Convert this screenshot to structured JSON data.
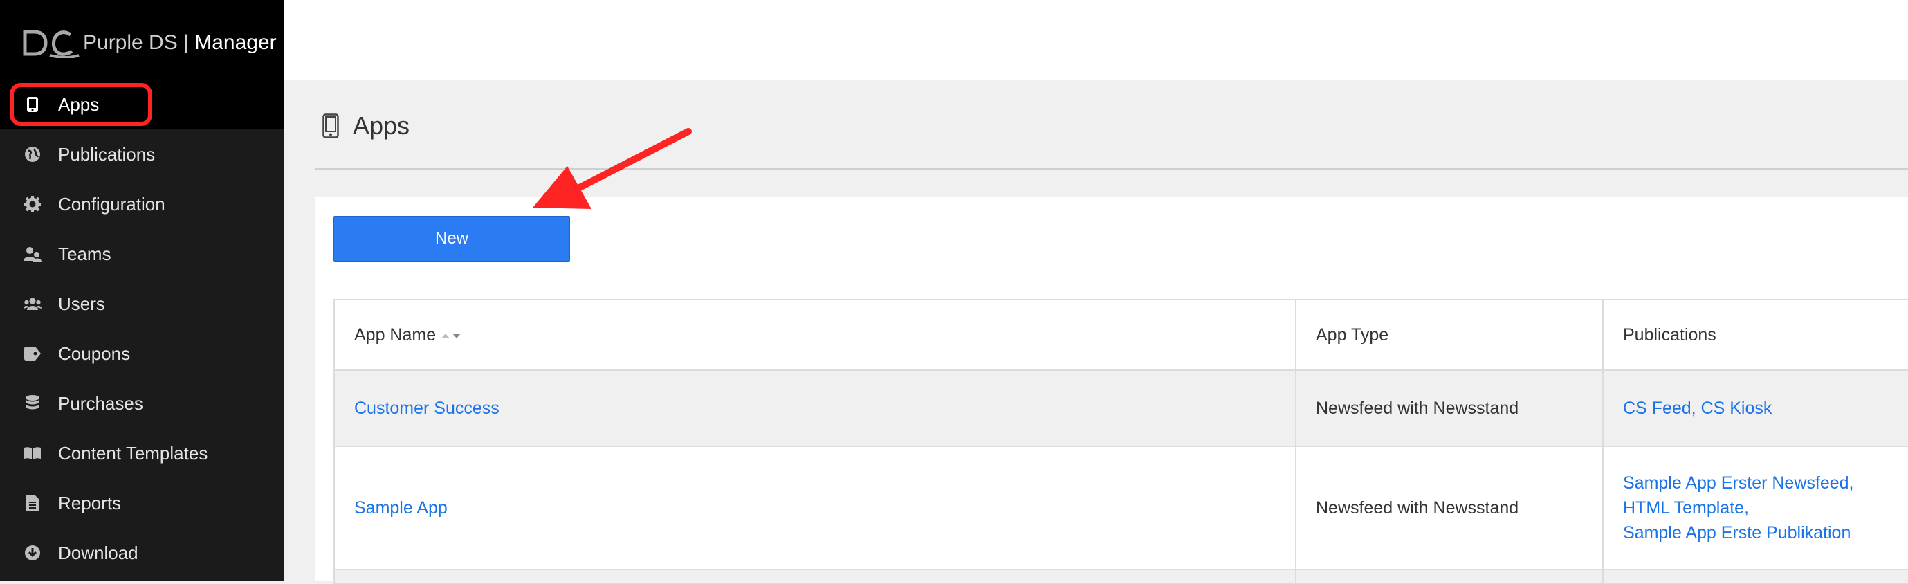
{
  "sidebar": {
    "brand": "Purple DS",
    "brand_separator": " | ",
    "brand_suffix": "Manager",
    "items": [
      {
        "label": "Apps",
        "icon": "tablet-icon",
        "active": true
      },
      {
        "label": "Publications",
        "icon": "globe-icon"
      },
      {
        "label": "Configuration",
        "icon": "gear-icon"
      },
      {
        "label": "Teams",
        "icon": "team-icon"
      },
      {
        "label": "Users",
        "icon": "users-icon"
      },
      {
        "label": "Coupons",
        "icon": "tag-icon"
      },
      {
        "label": "Purchases",
        "icon": "database-icon"
      },
      {
        "label": "Content Templates",
        "icon": "book-icon"
      },
      {
        "label": "Reports",
        "icon": "document-icon"
      },
      {
        "label": "Download",
        "icon": "download-icon"
      }
    ]
  },
  "page": {
    "title": "Apps",
    "icon": "tablet-icon",
    "new_button": "New"
  },
  "table": {
    "columns": [
      "App Name",
      "App Type",
      "Publications"
    ],
    "rows": [
      {
        "name": "Customer Success",
        "type": "Newsfeed with Newsstand",
        "publications": [
          "CS Feed, CS Kiosk"
        ]
      },
      {
        "name": "Sample App",
        "type": "Newsfeed with Newsstand",
        "publications": [
          "Sample App Erster Newsfeed,",
          "HTML Template,",
          "Sample App Erste Publikation"
        ]
      }
    ]
  },
  "colors": {
    "sidebar_bg": "#1b1b1b",
    "primary_button": "#2b7bf2",
    "link": "#1a73e8",
    "annotation": "#ff2424"
  }
}
